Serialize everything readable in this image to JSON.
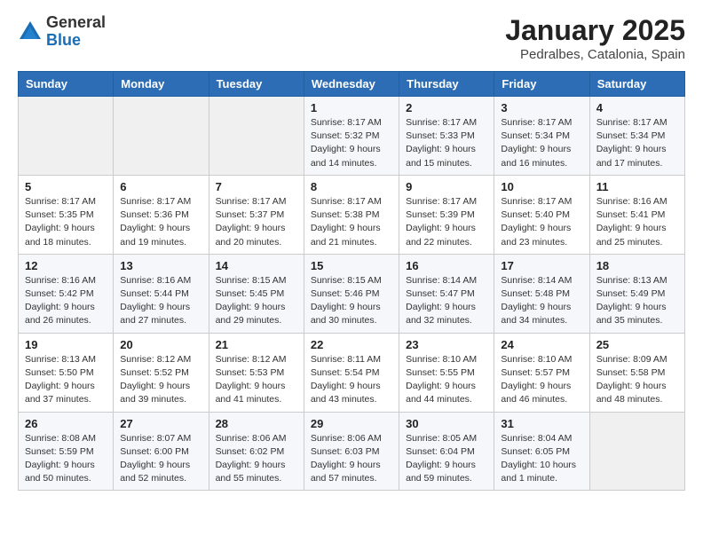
{
  "logo": {
    "general": "General",
    "blue": "Blue"
  },
  "title": "January 2025",
  "location": "Pedralbes, Catalonia, Spain",
  "weekdays": [
    "Sunday",
    "Monday",
    "Tuesday",
    "Wednesday",
    "Thursday",
    "Friday",
    "Saturday"
  ],
  "weeks": [
    [
      {
        "day": "",
        "info": ""
      },
      {
        "day": "",
        "info": ""
      },
      {
        "day": "",
        "info": ""
      },
      {
        "day": "1",
        "info": "Sunrise: 8:17 AM\nSunset: 5:32 PM\nDaylight: 9 hours\nand 14 minutes."
      },
      {
        "day": "2",
        "info": "Sunrise: 8:17 AM\nSunset: 5:33 PM\nDaylight: 9 hours\nand 15 minutes."
      },
      {
        "day": "3",
        "info": "Sunrise: 8:17 AM\nSunset: 5:34 PM\nDaylight: 9 hours\nand 16 minutes."
      },
      {
        "day": "4",
        "info": "Sunrise: 8:17 AM\nSunset: 5:34 PM\nDaylight: 9 hours\nand 17 minutes."
      }
    ],
    [
      {
        "day": "5",
        "info": "Sunrise: 8:17 AM\nSunset: 5:35 PM\nDaylight: 9 hours\nand 18 minutes."
      },
      {
        "day": "6",
        "info": "Sunrise: 8:17 AM\nSunset: 5:36 PM\nDaylight: 9 hours\nand 19 minutes."
      },
      {
        "day": "7",
        "info": "Sunrise: 8:17 AM\nSunset: 5:37 PM\nDaylight: 9 hours\nand 20 minutes."
      },
      {
        "day": "8",
        "info": "Sunrise: 8:17 AM\nSunset: 5:38 PM\nDaylight: 9 hours\nand 21 minutes."
      },
      {
        "day": "9",
        "info": "Sunrise: 8:17 AM\nSunset: 5:39 PM\nDaylight: 9 hours\nand 22 minutes."
      },
      {
        "day": "10",
        "info": "Sunrise: 8:17 AM\nSunset: 5:40 PM\nDaylight: 9 hours\nand 23 minutes."
      },
      {
        "day": "11",
        "info": "Sunrise: 8:16 AM\nSunset: 5:41 PM\nDaylight: 9 hours\nand 25 minutes."
      }
    ],
    [
      {
        "day": "12",
        "info": "Sunrise: 8:16 AM\nSunset: 5:42 PM\nDaylight: 9 hours\nand 26 minutes."
      },
      {
        "day": "13",
        "info": "Sunrise: 8:16 AM\nSunset: 5:44 PM\nDaylight: 9 hours\nand 27 minutes."
      },
      {
        "day": "14",
        "info": "Sunrise: 8:15 AM\nSunset: 5:45 PM\nDaylight: 9 hours\nand 29 minutes."
      },
      {
        "day": "15",
        "info": "Sunrise: 8:15 AM\nSunset: 5:46 PM\nDaylight: 9 hours\nand 30 minutes."
      },
      {
        "day": "16",
        "info": "Sunrise: 8:14 AM\nSunset: 5:47 PM\nDaylight: 9 hours\nand 32 minutes."
      },
      {
        "day": "17",
        "info": "Sunrise: 8:14 AM\nSunset: 5:48 PM\nDaylight: 9 hours\nand 34 minutes."
      },
      {
        "day": "18",
        "info": "Sunrise: 8:13 AM\nSunset: 5:49 PM\nDaylight: 9 hours\nand 35 minutes."
      }
    ],
    [
      {
        "day": "19",
        "info": "Sunrise: 8:13 AM\nSunset: 5:50 PM\nDaylight: 9 hours\nand 37 minutes."
      },
      {
        "day": "20",
        "info": "Sunrise: 8:12 AM\nSunset: 5:52 PM\nDaylight: 9 hours\nand 39 minutes."
      },
      {
        "day": "21",
        "info": "Sunrise: 8:12 AM\nSunset: 5:53 PM\nDaylight: 9 hours\nand 41 minutes."
      },
      {
        "day": "22",
        "info": "Sunrise: 8:11 AM\nSunset: 5:54 PM\nDaylight: 9 hours\nand 43 minutes."
      },
      {
        "day": "23",
        "info": "Sunrise: 8:10 AM\nSunset: 5:55 PM\nDaylight: 9 hours\nand 44 minutes."
      },
      {
        "day": "24",
        "info": "Sunrise: 8:10 AM\nSunset: 5:57 PM\nDaylight: 9 hours\nand 46 minutes."
      },
      {
        "day": "25",
        "info": "Sunrise: 8:09 AM\nSunset: 5:58 PM\nDaylight: 9 hours\nand 48 minutes."
      }
    ],
    [
      {
        "day": "26",
        "info": "Sunrise: 8:08 AM\nSunset: 5:59 PM\nDaylight: 9 hours\nand 50 minutes."
      },
      {
        "day": "27",
        "info": "Sunrise: 8:07 AM\nSunset: 6:00 PM\nDaylight: 9 hours\nand 52 minutes."
      },
      {
        "day": "28",
        "info": "Sunrise: 8:06 AM\nSunset: 6:02 PM\nDaylight: 9 hours\nand 55 minutes."
      },
      {
        "day": "29",
        "info": "Sunrise: 8:06 AM\nSunset: 6:03 PM\nDaylight: 9 hours\nand 57 minutes."
      },
      {
        "day": "30",
        "info": "Sunrise: 8:05 AM\nSunset: 6:04 PM\nDaylight: 9 hours\nand 59 minutes."
      },
      {
        "day": "31",
        "info": "Sunrise: 8:04 AM\nSunset: 6:05 PM\nDaylight: 10 hours\nand 1 minute."
      },
      {
        "day": "",
        "info": ""
      }
    ]
  ]
}
